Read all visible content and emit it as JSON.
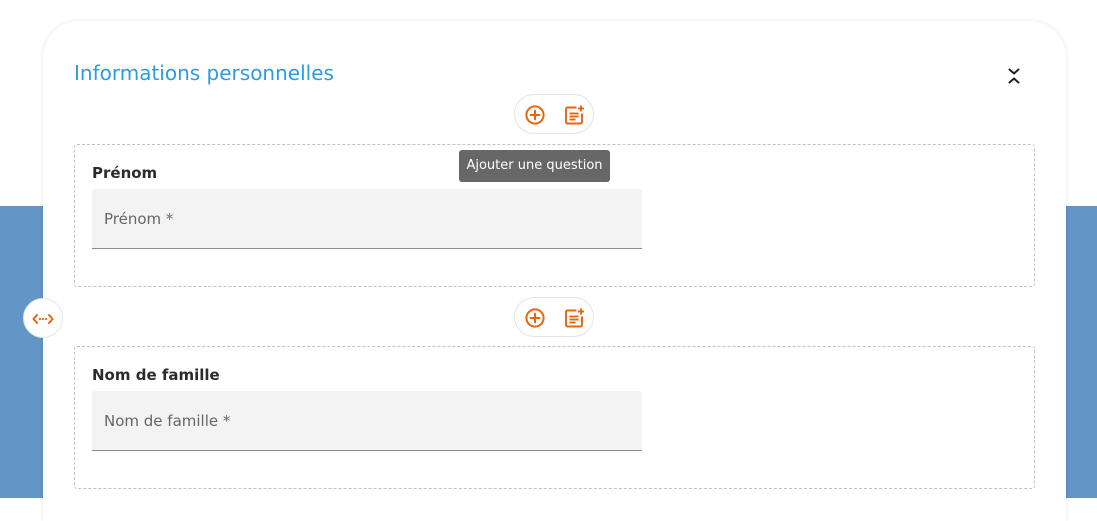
{
  "section": {
    "title": "Informations personnelles",
    "collapse_icon": "collapse-chevrons-icon"
  },
  "toolbar": {
    "add_question_icon": "plus-circle-icon",
    "add_block_icon": "note-add-icon",
    "tooltip": "Ajouter une question"
  },
  "questions": [
    {
      "label": "Prénom",
      "placeholder": "Prénom *"
    },
    {
      "label": "Nom de famille",
      "placeholder": "Nom de famille *"
    }
  ],
  "side_handle_icon": "resize-horizontal-icon",
  "colors": {
    "accent": "#e8650e",
    "title": "#2f9ae0",
    "background_band": "#6395c7",
    "tooltip_bg": "#676767",
    "input_bg": "#f3f3f3"
  }
}
